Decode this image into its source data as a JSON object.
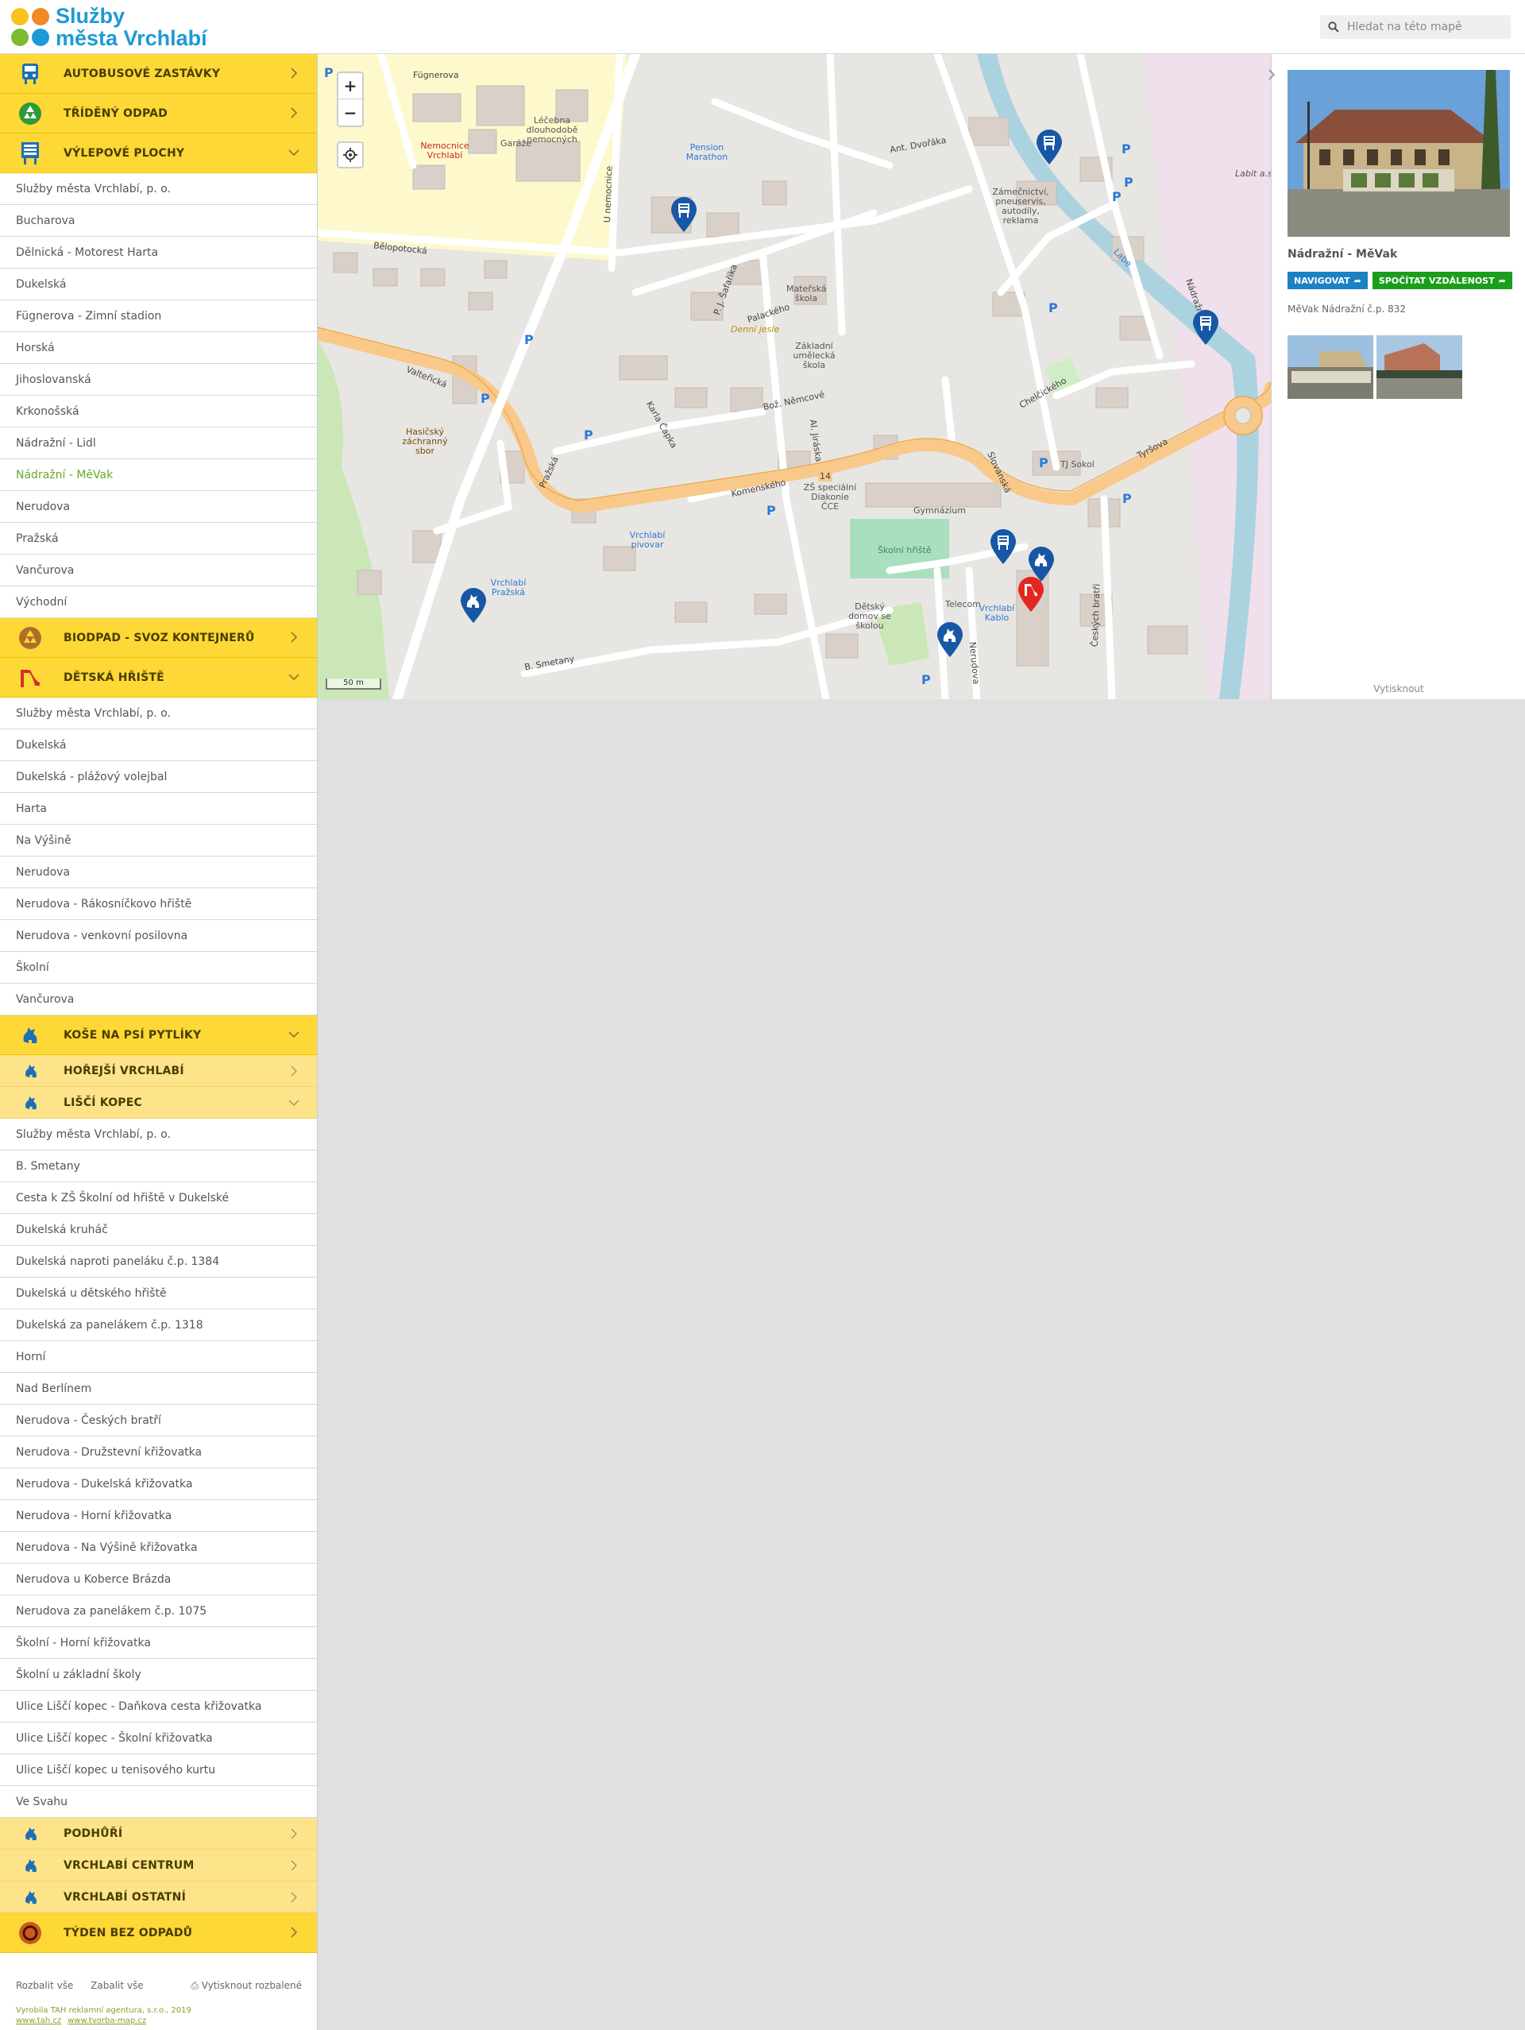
{
  "header": {
    "logo_line1": "Služby",
    "logo_line2": "města Vrchlabí",
    "search_placeholder": "Hledat na této mapě"
  },
  "sidebar": {
    "cat_bus": "AUTOBUSOVÉ ZASTÁVKY",
    "cat_waste": "TŘÍDĚNÝ ODPAD",
    "cat_posters": "VÝLEPOVÉ PLOCHY",
    "posters_items": [
      "Služby města Vrchlabí, p. o.",
      "Bucharova",
      "Dělnická - Motorest Harta",
      "Dukelská",
      "Fügnerova - Zimní stadion",
      "Horská",
      "Jihoslovanská",
      "Krkonošská",
      "Nádražní - Lidl",
      "Nádražní - MěVak",
      "Nerudova",
      "Pražská",
      "Vančurova",
      "Východní"
    ],
    "cat_biowaste": "BIODPAD - SVOZ KONTEJNERŮ",
    "cat_playgrounds": "DĚTSKÁ HŘIŠTĚ",
    "playgrounds_items": [
      "Služby města Vrchlabí, p. o.",
      "Dukelská",
      "Dukelská - plážový volejbal",
      "Harta",
      "Na Výšině",
      "Nerudova",
      "Nerudova - Rákosníčkovo hřiště",
      "Nerudova - venkovní posilovna",
      "Školní",
      "Vančurova"
    ],
    "cat_dogbins": "KOŠE NA PSÍ PYTLÍKY",
    "sub_horejsi": "HOŘEJŠÍ VRCHLABÍ",
    "sub_lisci": "LIŠČÍ KOPEC",
    "lisci_items": [
      "Služby města Vrchlabí, p. o.",
      "B. Smetany",
      "Cesta k ZŠ Školní od hřiště v Dukelské",
      "Dukelská kruháč",
      "Dukelská naproti paneláku č.p. 1384",
      "Dukelská u dětského hřiště",
      "Dukelská za panelákem č.p. 1318",
      "Horní",
      "Nad Berlínem",
      "Nerudova - Českých bratří",
      "Nerudova - Družstevní křižovatka",
      "Nerudova - Dukelská křižovatka",
      "Nerudova - Horní křižovatka",
      "Nerudova - Na Výšině křižovatka",
      "Nerudova u Koberce Brázda",
      "Nerudova za panelákem č.p. 1075",
      "Školní - Horní křižovatka",
      "Školní u základní školy",
      "Ulice Liščí kopec - Daňkova cesta křižovatka",
      "Ulice Liščí kopec - Školní křižovatka",
      "Ulice Liščí kopec u tenisového kurtu",
      "Ve Svahu"
    ],
    "sub_podhuri": "PODHŮŘÍ",
    "sub_centrum": "VRCHLABÍ CENTRUM",
    "sub_ostatni": "VRCHLABÍ OSTATNÍ",
    "cat_noweek": "TÝDEN BEZ ODPADŮ",
    "expand_all": "Rozbalit vše",
    "collapse_all": "Zabalit vše",
    "print_expanded": "Vytisknout rozbalené",
    "credit": "Vyrobila TAH reklamní agentura, s.r.o., 2019",
    "credit_link1": "www.tah.cz",
    "credit_link2": "www.tvorba-map.cz"
  },
  "map": {
    "zoom_in": "+",
    "zoom_out": "−",
    "scale": "50 m",
    "labels": {
      "fugnerova": "Fügnerova",
      "nemocnice": "Nemocnice Vrchlabí",
      "lecebna": "Léčebna dlouhodobě nemocných",
      "garaze": "Garáže",
      "pension": "Pension Marathon",
      "belopotocka": "Bělopotocká",
      "valtericka": "Valteřická",
      "prazska": "Pražská",
      "hasici": "Hasičský záchranný sbor",
      "karla_capka": "Karla Čapka",
      "safarika": "P. J. Šafaříka",
      "palackeho": "Palackého",
      "materska": "Mateřská škola",
      "denni": "Denní jesle",
      "zakladni": "Základní umělecká škola",
      "bozeny": "Bož. Němcové",
      "jiraska": "Al. Jiráska",
      "komenskeho": "Komenského",
      "zs": "ZŠ speciální Diakonie ČCE",
      "gymnazium": "Gymnázium",
      "skolni_hriste": "Školní hřiště",
      "pivovar": "Vrchlabí pivovar",
      "prazska_stop": "Vrchlabí Pražská",
      "detsky": "Dětský domov se školou",
      "telecom": "Telecom",
      "kablo": "Vrchlabí Kablo",
      "smetany": "B. Smetany",
      "nerudova": "Nerudova",
      "ceskych": "Českých bratří",
      "tyrsova": "Tyršova",
      "tj_sokol": "TJ Sokol",
      "chelcickeho": "Chelčického",
      "slovanska": "Slovanská",
      "nadrazni": "Nádražní",
      "labe": "Labe",
      "zamecnictvi": "Zámečnictví, pneuservis, autodíly, reklama",
      "dvoraka": "Ant. Dvořáka",
      "labit": "Labit a.s.",
      "road14": "14",
      "u_nemocnice": "U nemocnice"
    }
  },
  "panel": {
    "title": "Nádražní - MěVak",
    "navigate": "NAVIGOVAT",
    "distance": "SPOČÍTAT VZDÁLENOST",
    "description": "MěVak Nádražní č.p. 832",
    "print": "Vytisknout"
  },
  "colors": {
    "category": "#fdd836",
    "subcategory": "#fde38a",
    "active_item": "#6aa728",
    "brand_blue": "#1e9ad6",
    "navigate_button": "#1b82c5",
    "distance_button": "#1b9e1b"
  }
}
